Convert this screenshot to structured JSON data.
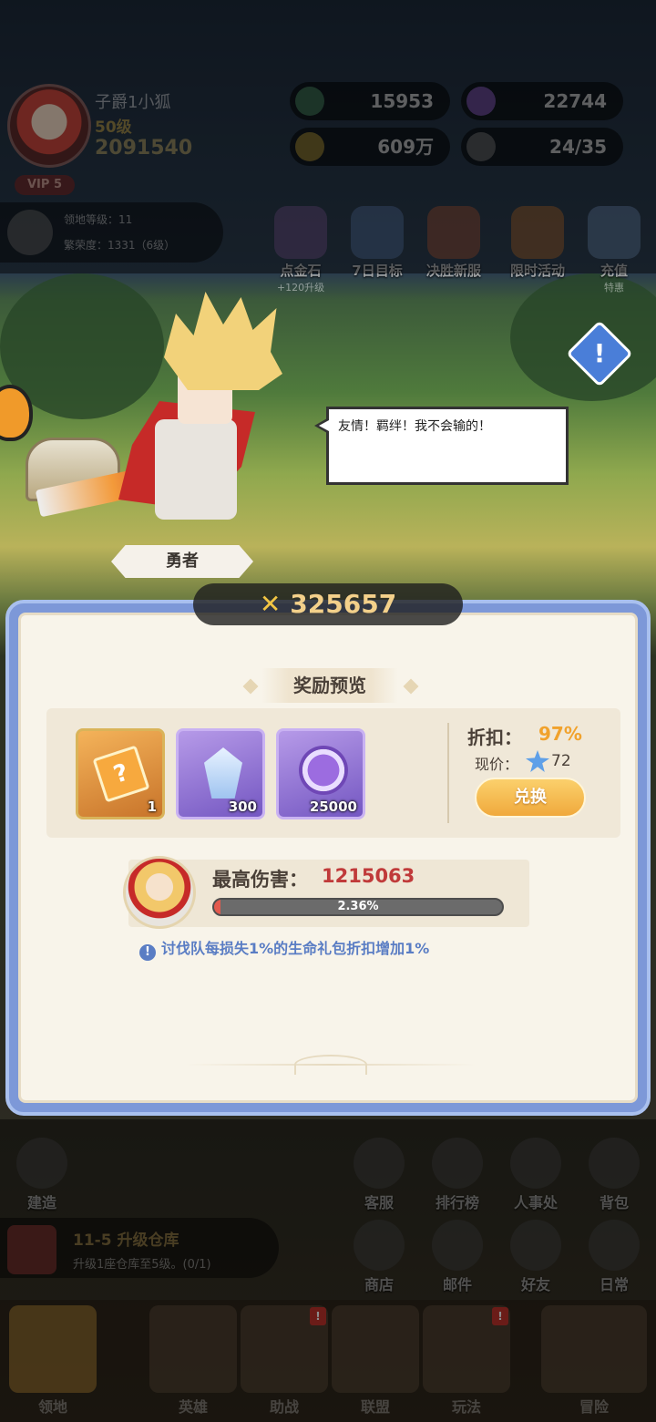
{
  "player": {
    "name": "子爵1小狐",
    "level": "50级",
    "power": "2091540",
    "vip": "VIP 5"
  },
  "resources": {
    "stars": "15953",
    "purple_coins": "22744",
    "gold": "609万",
    "team": "24/35"
  },
  "territory": {
    "level_label": "领地等级：11",
    "prosperity_label": "繁荣度：1331（6级）"
  },
  "activities": [
    {
      "label": "点金石",
      "sub": "+120升级",
      "icon": "gold-stone-icon"
    },
    {
      "label": "7日目标",
      "sub": "",
      "icon": "calendar-icon"
    },
    {
      "label": "决胜新服",
      "sub": "",
      "icon": "crossed-swords-icon"
    },
    {
      "label": "限时活动",
      "sub": "",
      "icon": "treasure-chest-icon"
    },
    {
      "label": "充值",
      "sub": "特惠",
      "icon": "gift-box-icon"
    }
  ],
  "speech": "友情！羁绊！我不会输的！",
  "hero_tag": "勇者",
  "panel": {
    "power": "325657",
    "title": "奖励预览",
    "items": [
      {
        "name": "mystery-card",
        "qty": "1",
        "symbol": "?"
      },
      {
        "name": "crystal",
        "qty": "300"
      },
      {
        "name": "purple-coin",
        "qty": "25000"
      }
    ],
    "discount_label": "折扣：",
    "discount_value": "97%",
    "price_label": "现价：",
    "price_value": "72",
    "exchange_label": "兑换",
    "max_damage_label": "最高伤害：",
    "max_damage_value": "1215063",
    "progress_text": "2.36%",
    "progress_fraction": 0.0236,
    "hint_icon": "!",
    "hint": "讨伐队每损失1%的生命礼包折扣增加1%"
  },
  "side_buttons": [
    {
      "label": "建造",
      "icon": "hammer-icon"
    },
    {
      "label": "客服",
      "icon": "headset-icon"
    },
    {
      "label": "排行榜",
      "icon": "trophy-icon"
    },
    {
      "label": "人事处",
      "icon": "building-icon"
    },
    {
      "label": "背包",
      "icon": "backpack-icon"
    },
    {
      "label": "商店",
      "icon": "shop-icon"
    },
    {
      "label": "邮件",
      "icon": "mail-icon"
    },
    {
      "label": "好友",
      "icon": "friends-icon"
    },
    {
      "label": "日常",
      "icon": "scroll-icon"
    }
  ],
  "quest": {
    "title": "11-5 升级仓库",
    "desc": "升级1座仓库至5级。(0/1)"
  },
  "tabs": [
    {
      "label": "领地",
      "badge": ""
    },
    {
      "label": "英雄",
      "badge": ""
    },
    {
      "label": "助战",
      "badge": "!"
    },
    {
      "label": "联盟",
      "badge": ""
    },
    {
      "label": "玩法",
      "badge": "!"
    },
    {
      "label": "冒险",
      "badge": ""
    }
  ],
  "colors": {
    "panel_border": "#7d98d8",
    "discount": "#f1a22c",
    "damage": "#c03a3a",
    "button": "#f0a93c",
    "hint": "#5a7dc4"
  }
}
